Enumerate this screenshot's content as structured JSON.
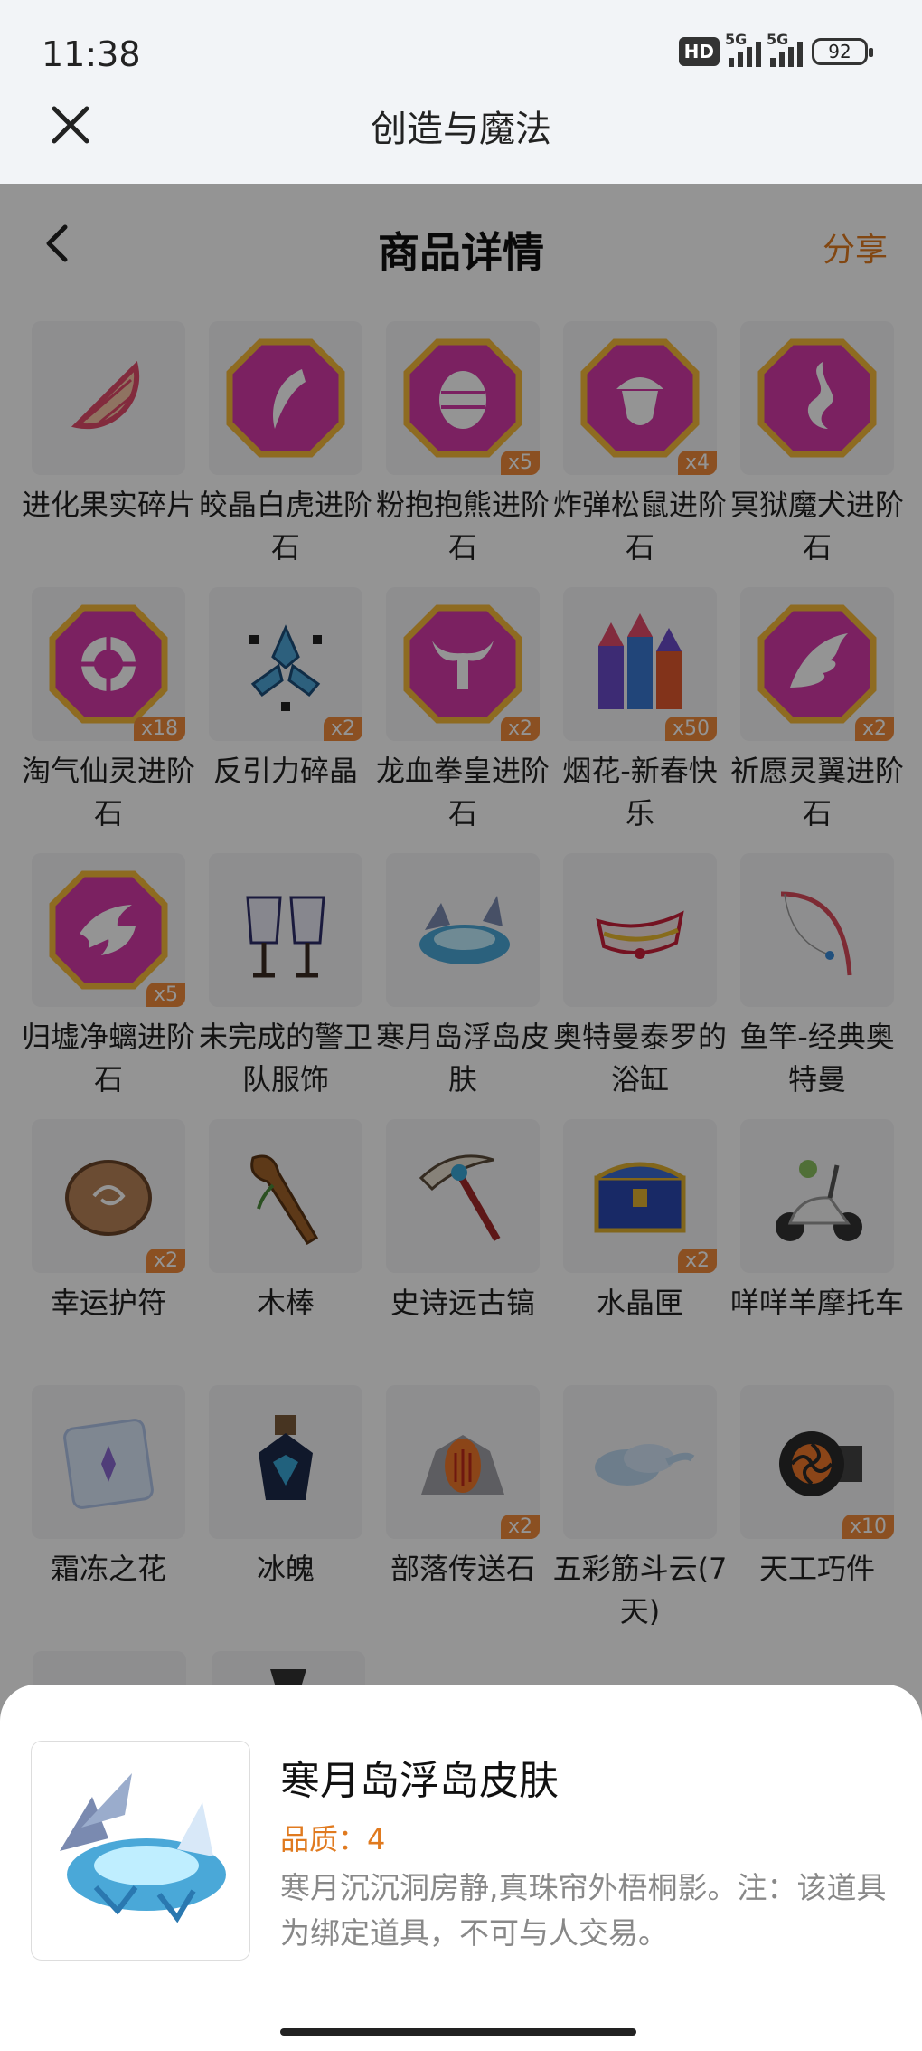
{
  "status_bar": {
    "time": "11:38",
    "hd": "HD",
    "net1": "5G",
    "net2": "5G",
    "battery": "92"
  },
  "app_bar": {
    "title": "创造与魔法"
  },
  "nav": {
    "title": "商品详情",
    "share": "分享"
  },
  "items": [
    {
      "name": "进化果实碎片",
      "qty": "",
      "icon": "fruit-shard-icon"
    },
    {
      "name": "皎晶白虎进阶石",
      "qty": "",
      "icon": "fang-gem-icon"
    },
    {
      "name": "粉抱抱熊进阶石",
      "qty": "x5",
      "icon": "egg-gem-icon"
    },
    {
      "name": "炸弹松鼠进阶石",
      "qty": "x4",
      "icon": "acorn-gem-icon"
    },
    {
      "name": "冥狱魔犬进阶石",
      "qty": "",
      "icon": "flame-gem-icon"
    },
    {
      "name": "淘气仙灵进阶石",
      "qty": "x18",
      "icon": "fairy-gem-icon"
    },
    {
      "name": "反引力碎晶",
      "qty": "x2",
      "icon": "antigravity-crystal-icon"
    },
    {
      "name": "龙血拳皇进阶石",
      "qty": "x2",
      "icon": "bull-gem-icon"
    },
    {
      "name": "烟花-新春快乐",
      "qty": "x50",
      "icon": "firework-icon"
    },
    {
      "name": "祈愿灵翼进阶石",
      "qty": "x2",
      "icon": "wing-gem-icon"
    },
    {
      "name": "归墟净螭进阶石",
      "qty": "x5",
      "icon": "wave-gem-icon"
    },
    {
      "name": "未完成的警卫队服饰",
      "qty": "",
      "icon": "guard-outfit-icon"
    },
    {
      "name": "寒月岛浮岛皮肤",
      "qty": "",
      "icon": "floating-island-icon"
    },
    {
      "name": "奥特曼泰罗的浴缸",
      "qty": "",
      "icon": "bathtub-icon"
    },
    {
      "name": "鱼竿-经典奥特曼",
      "qty": "",
      "icon": "fishing-rod-icon"
    },
    {
      "name": "幸运护符",
      "qty": "x2",
      "icon": "amulet-icon"
    },
    {
      "name": "木棒",
      "qty": "",
      "icon": "club-icon"
    },
    {
      "name": "史诗远古镐",
      "qty": "",
      "icon": "pickaxe-icon"
    },
    {
      "name": "水晶匣",
      "qty": "x2",
      "icon": "chest-icon"
    },
    {
      "name": "咩咩羊摩托车",
      "qty": "",
      "icon": "scooter-icon"
    },
    {
      "name": "霜冻之花",
      "qty": "",
      "icon": "frost-flower-icon"
    },
    {
      "name": "冰魄",
      "qty": "",
      "icon": "ice-potion-icon"
    },
    {
      "name": "部落传送石",
      "qty": "x2",
      "icon": "teleport-stone-icon"
    },
    {
      "name": "五彩筋斗云(7天)",
      "qty": "",
      "icon": "cloud-icon"
    },
    {
      "name": "天工巧件",
      "qty": "x10",
      "icon": "gear-part-icon"
    }
  ],
  "detail": {
    "name": "寒月岛浮岛皮肤",
    "quality": "品质：4",
    "description": "寒月沉沉洞房静,真珠帘外梧桐影。注：该道具为绑定道具，不可与人交易。"
  }
}
